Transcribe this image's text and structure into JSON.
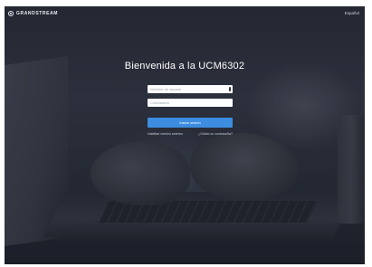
{
  "header": {
    "brand_name": "GRANDSTREAM",
    "language": "Español"
  },
  "login": {
    "title": "Bienvenida a la UCM6302",
    "username_placeholder": "Nombre de usuario",
    "password_placeholder": "Contraseña",
    "submit_label": "Iniciar sesión",
    "left_link": "Habilitar versión anterior",
    "right_link": "¿Olvidó su contraseña?"
  },
  "colors": {
    "accent": "#3c8de0",
    "background": "#2c313b",
    "text": "#ffffff"
  },
  "icons": {
    "logo": "grandstream-logo-icon",
    "username_field": "user-icon",
    "password_field": "lock-icon"
  }
}
